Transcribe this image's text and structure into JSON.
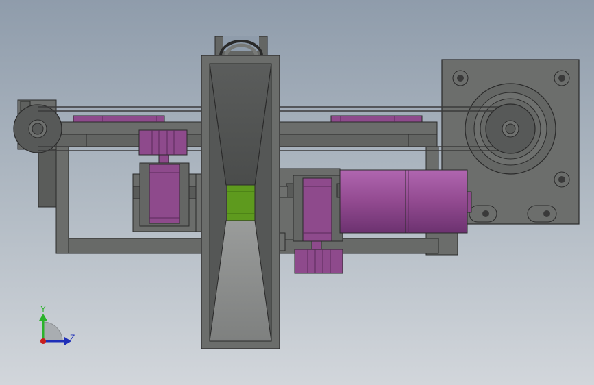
{
  "triad": {
    "y_label": "Y",
    "z_label": "Z",
    "y_color": "#2bb32b",
    "z_color": "#1f2fb8",
    "x_color": "#c81e1e"
  },
  "colors": {
    "steel": "#6b6d6b",
    "steel_dark": "#4e504e",
    "edge": "#2a2a2a",
    "purple": "#8e4a8c",
    "purple_light": "#a05aa0",
    "green": "#5e9a1e",
    "plate": "#6a6c6a"
  }
}
